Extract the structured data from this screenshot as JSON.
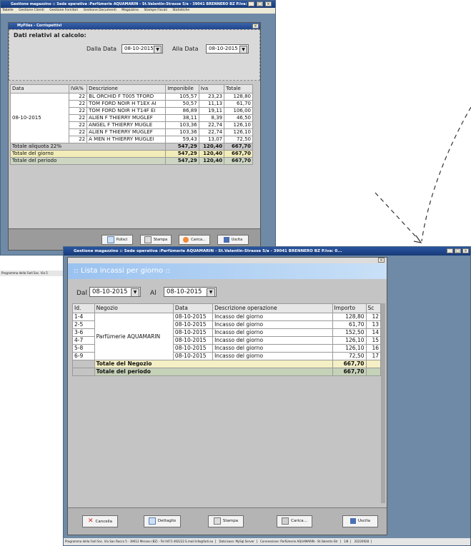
{
  "back_window": {
    "title": "Gestione magazzino :: Sede operativa :Parfümerie AQUAMARIN - St.Valentin-Strasse 5/a - 39041 BRENNERO BZ P.Iva: 0...",
    "menu": [
      "Tabelle",
      "Gestione Clienti",
      "Gestione Fornitori",
      "Gestione Documenti",
      "Magazzino",
      "Stampe Fiscali",
      "Statistiche"
    ],
    "child_title": "MyFiles - Corrispettivi",
    "section_label": "Dati relativi al calcolo:",
    "from_label": "Dalla Data",
    "from_value": "08-10-2015",
    "to_label": "Alla Data",
    "to_value": "08-10-2015",
    "columns": [
      "Data",
      "IVA%",
      "Descrizione",
      "Imponibile",
      "Iva",
      "Totale"
    ],
    "date": "08-10-2015",
    "rows": [
      {
        "iva": "22",
        "desc": "BL ORCHID F T005 TFORD",
        "imp": "105,57",
        "iva_amt": "23,23",
        "tot": "128,80"
      },
      {
        "iva": "22",
        "desc": "TOM FORD NOIR H T1EX AI",
        "imp": "50,57",
        "iva_amt": "11,13",
        "tot": "61,70"
      },
      {
        "iva": "22",
        "desc": "TOM FORD NOIR H T14F EI",
        "imp": "86,89",
        "iva_amt": "19,11",
        "tot": "106,00"
      },
      {
        "iva": "22",
        "desc": "ALIEN F THIERRY MUGLEF",
        "imp": "38,11",
        "iva_amt": "8,39",
        "tot": "46,50"
      },
      {
        "iva": "22",
        "desc": "ANGEL F THIERRY MUGLE",
        "imp": "103,36",
        "iva_amt": "22,74",
        "tot": "126,10"
      },
      {
        "iva": "22",
        "desc": "ALIEN F THIERRY MUGLEF",
        "imp": "103,36",
        "iva_amt": "22,74",
        "tot": "126,10"
      },
      {
        "iva": "22",
        "desc": "A MEN H THIERRY MUGLEI",
        "imp": "59,43",
        "iva_amt": "13,07",
        "tot": "72,50"
      }
    ],
    "totals": [
      {
        "label": "Totale aliquota 22%",
        "imp": "547,29",
        "iva": "120,40",
        "tot": "667,70",
        "style": "gray"
      },
      {
        "label": "Totale del giorno",
        "imp": "547,29",
        "iva": "120,40",
        "tot": "667,70",
        "style": "yellow"
      },
      {
        "label": "Totale del periodo",
        "imp": "547,29",
        "iva": "120,40",
        "tot": "667,70",
        "style": "sage"
      }
    ],
    "buttons": [
      "Pulisci",
      "Stampa",
      "Carica...",
      "Uscita"
    ],
    "status": "Programma della Fodi Snc. Via 5"
  },
  "front_window": {
    "title": "Gestione magazzino :: Sede operativa :Parfümerie AQUAMARIN - St.Valentin-Strasse 5/a - 39041 BRENNERO BZ P.Iva: 0...",
    "header": ":: Lista incassi per giorno ::",
    "dal_label": "Dal",
    "dal_value": "08-10-2015",
    "al_label": "Al",
    "al_value": "08-10-2015",
    "columns": [
      "Id.",
      "Negozio",
      "Data",
      "Descrizione operazione",
      "Importo",
      "Sc"
    ],
    "store": "Parfümerie AQUAMARIN",
    "rows": [
      {
        "id": "1-4",
        "date": "08-10-2015",
        "desc": "Incasso del giorno",
        "amount": "128,80",
        "sc": "12"
      },
      {
        "id": "2-5",
        "date": "08-10-2015",
        "desc": "Incasso del giorno",
        "amount": "61,70",
        "sc": "13"
      },
      {
        "id": "3-6",
        "date": "08-10-2015",
        "desc": "Incasso del giorno",
        "amount": "152,50",
        "sc": "14"
      },
      {
        "id": "4-7",
        "date": "08-10-2015",
        "desc": "Incasso del giorno",
        "amount": "126,10",
        "sc": "15"
      },
      {
        "id": "5-8",
        "date": "08-10-2015",
        "desc": "Incasso del giorno",
        "amount": "126,10",
        "sc": "16"
      },
      {
        "id": "6-9",
        "date": "08-10-2015",
        "desc": "Incasso del giorno",
        "amount": "72,50",
        "sc": "17"
      }
    ],
    "total_store_label": "Totale del Negozio",
    "total_store_value": "667,70",
    "total_period_label": "Totale del periodo",
    "total_period_value": "667,70",
    "buttons": [
      "Cancella",
      "Dettaglio",
      "Stampa",
      "Carica...",
      "Uscita"
    ],
    "status": [
      "Programma della Fodi Snc. Via San Rocco 5 - 39012 Merano (BZ) - Tel 0473 492222 E.mail:info@fodi.eu",
      "Data base: MySql Server",
      "Connessione: Parfümerie AQUAMARIN - St.Valentin-Str",
      "1/8",
      "20220928"
    ]
  }
}
